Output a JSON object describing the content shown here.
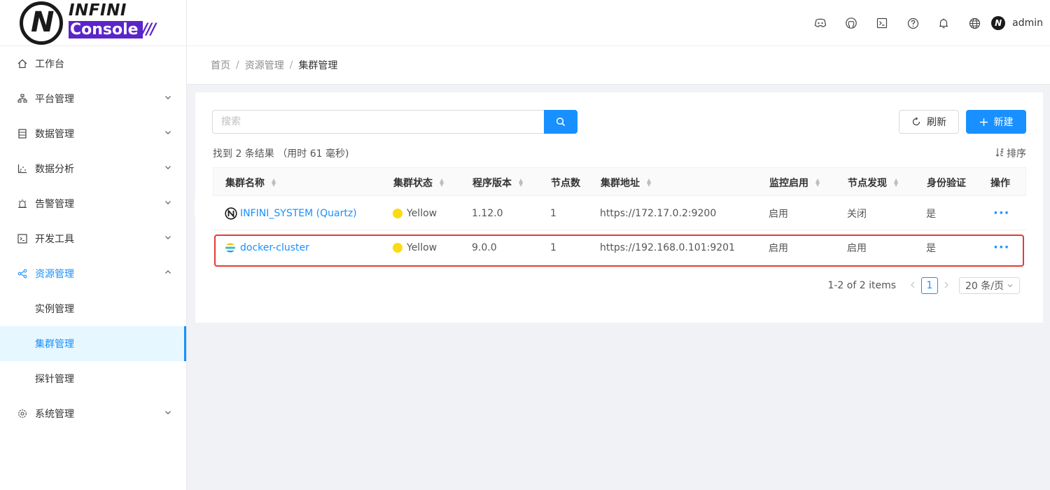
{
  "app": {
    "logo_top": "INFINI",
    "logo_bottom": "Console",
    "logo_slashes": "///"
  },
  "header": {
    "icons": [
      "discord-icon",
      "github-icon",
      "terminal-icon",
      "help-icon",
      "bell-icon",
      "globe-icon"
    ],
    "user": "admin"
  },
  "sidebar": {
    "items": [
      {
        "label": "工作台",
        "icon": "home-icon",
        "has_arrow": false
      },
      {
        "label": "平台管理",
        "icon": "cluster-icon",
        "has_arrow": true
      },
      {
        "label": "数据管理",
        "icon": "database-icon",
        "has_arrow": true
      },
      {
        "label": "数据分析",
        "icon": "chart-icon",
        "has_arrow": true
      },
      {
        "label": "告警管理",
        "icon": "alarm-icon",
        "has_arrow": true
      },
      {
        "label": "开发工具",
        "icon": "console-icon",
        "has_arrow": true
      },
      {
        "label": "资源管理",
        "icon": "share-icon",
        "has_arrow": true,
        "open": true
      },
      {
        "label": "系统管理",
        "icon": "settings-icon",
        "has_arrow": true
      }
    ],
    "submenu": [
      {
        "label": "实例管理",
        "active": false
      },
      {
        "label": "集群管理",
        "active": true
      },
      {
        "label": "探针管理",
        "active": false
      }
    ]
  },
  "breadcrumb": {
    "home": "首页",
    "parent": "资源管理",
    "current": "集群管理",
    "sep": "/"
  },
  "toolbar": {
    "search_placeholder": "搜索",
    "refresh_label": "刷新",
    "new_label": "新建",
    "result_text": "找到 2 条结果 （用时 61 毫秒)",
    "sort_label": "排序"
  },
  "table": {
    "columns": [
      "集群名称",
      "集群状态",
      "程序版本",
      "节点数",
      "集群地址",
      "监控启用",
      "节点发现",
      "身份验证",
      "操作"
    ],
    "rows": [
      {
        "name": "INFINI_SYSTEM (Quartz)",
        "icon": "infini-icon",
        "status": "Yellow",
        "version": "1.12.0",
        "nodes": "1",
        "address": "https://172.17.0.2:9200",
        "monitor": "启用",
        "discovery": "关闭",
        "auth": "是",
        "ops": "···"
      },
      {
        "name": "docker-cluster",
        "icon": "elasticsearch-icon",
        "status": "Yellow",
        "version": "9.0.0",
        "nodes": "1",
        "address": "https://192.168.0.101:9201",
        "monitor": "启用",
        "discovery": "启用",
        "auth": "是",
        "ops": "···"
      }
    ]
  },
  "pagination": {
    "total_text": "1-2 of 2 items",
    "current_page": "1",
    "page_size": "20 条/页"
  },
  "colors": {
    "primary": "#1890ff",
    "status_yellow": "#fadb14",
    "highlight": "#e53935",
    "brand_purple": "#5b25c9"
  }
}
